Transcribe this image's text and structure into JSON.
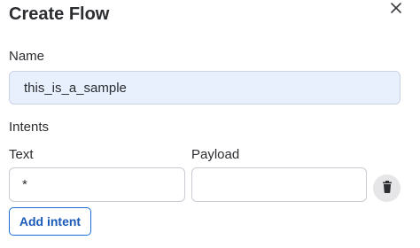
{
  "dialog": {
    "title": "Create Flow",
    "close_icon": "close-icon"
  },
  "name_field": {
    "label": "Name",
    "value": "this_is_a_sample"
  },
  "intents": {
    "section_label": "Intents",
    "columns": {
      "text_label": "Text",
      "payload_label": "Payload"
    },
    "rows": [
      {
        "text": "*",
        "payload": "",
        "delete_icon": "trash-icon"
      }
    ],
    "add_button_label": "Add intent"
  },
  "colors": {
    "accent": "#1a6fd6",
    "name_input_bg": "#e8f0fe",
    "delete_button_bg": "#e6e6e8"
  }
}
